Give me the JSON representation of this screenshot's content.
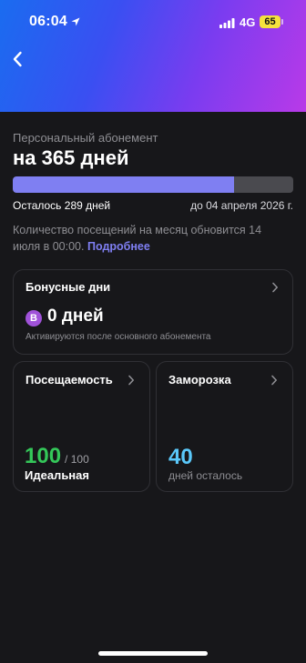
{
  "status_bar": {
    "time": "06:04",
    "network": "4G",
    "battery": "65",
    "location_icon": "location-arrow-icon",
    "signal_icon": "cellular-signal-icon"
  },
  "header": {
    "back_icon": "chevron-left-icon",
    "gradient": [
      "#1a6cf0",
      "#3a4ff2",
      "#7a3cf0",
      "#b93ae8"
    ]
  },
  "subscription": {
    "subtitle": "Персональный абонемент",
    "title": "на 365 дней",
    "progress_fraction": 0.79,
    "remaining": "Осталось 289 дней",
    "until": "до 04 апреля 2026 г.",
    "notice": "Количество посещений на месяц обновится 14 июля в 00:00.",
    "more_link": "Подробнее"
  },
  "bonus": {
    "title": "Бонусные дни",
    "badge": "B",
    "value": "0 дней",
    "note": "Активируются после основного абонемента"
  },
  "attendance": {
    "title": "Посещаемость",
    "value": "100",
    "total": "/ 100",
    "label": "Идеальная"
  },
  "freeze": {
    "title": "Заморозка",
    "value": "40",
    "label": "дней осталось"
  },
  "colors": {
    "accent": "#7f7ff2",
    "green": "#34c759",
    "blue": "#5ac8fa",
    "badge": "#a052d9",
    "battery": "#f5e23c"
  }
}
